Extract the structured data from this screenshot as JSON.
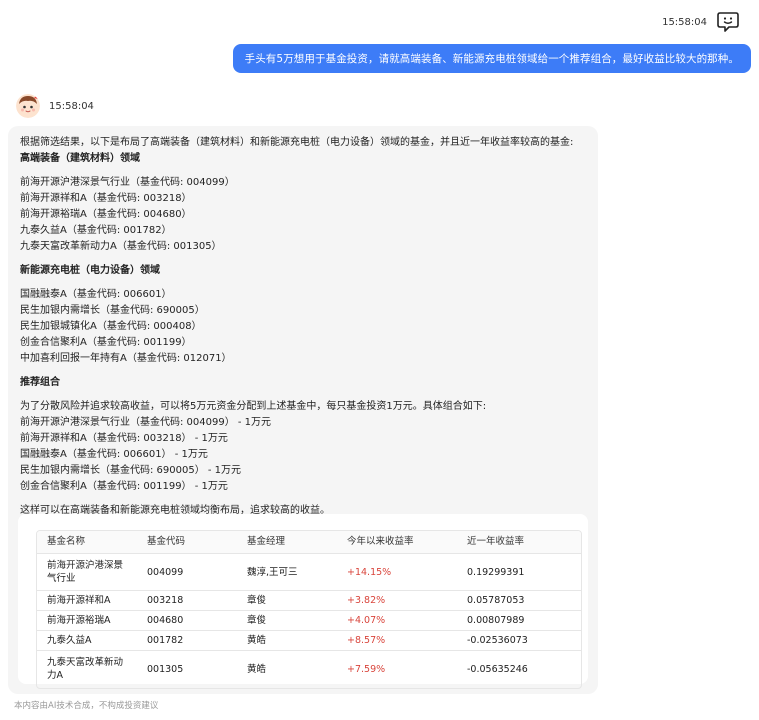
{
  "user": {
    "time": "15:58:04",
    "message": "手头有5万想用于基金投资，请就高端装备、新能源充电桩领域给一个推荐组合，最好收益比较大的那种。"
  },
  "bot": {
    "time": "15:58:04",
    "intro": "根据筛选结果，以下是布局了高端装备（建筑材料）和新能源充电桩（电力设备）领域的基金，并且近一年收益率较高的基金:",
    "section1": {
      "title": "高端装备（建筑材料）领域",
      "items": [
        "前海开源沪港深景气行业（基金代码: 004099）",
        "前海开源祥和A（基金代码: 003218）",
        "前海开源裕瑞A（基金代码: 004680）",
        "九泰久益A（基金代码: 001782）",
        "九泰天富改革新动力A（基金代码: 001305）"
      ]
    },
    "section2": {
      "title": "新能源充电桩（电力设备）领域",
      "items": [
        "国融融泰A（基金代码: 006601）",
        "民生加银内需增长（基金代码: 690005）",
        "民生加银城镇化A（基金代码: 000408）",
        "创金合信聚利A（基金代码: 001199）",
        "中加喜利回报一年持有A（基金代码: 012071）"
      ]
    },
    "section3": {
      "title": "推荐组合",
      "intro": "为了分散风险并追求较高收益，可以将5万元资金分配到上述基金中，每只基金投资1万元。具体组合如下:",
      "items": [
        "前海开源沪港深景气行业（基金代码: 004099） - 1万元",
        "前海开源祥和A（基金代码: 003218） - 1万元",
        "国融融泰A（基金代码: 006601） - 1万元",
        "民生加银内需增长（基金代码: 690005） - 1万元",
        "创金合信聚利A（基金代码: 001199） - 1万元"
      ]
    },
    "conclusion": "这样可以在高端装备和新能源充电桩领域均衡布局，追求较高的收益。"
  },
  "table": {
    "headers": [
      "基金名称",
      "基金代码",
      "基金经理",
      "今年以来收益率",
      "近一年收益率"
    ],
    "rows": [
      {
        "name": "前海开源沪港深景气行业",
        "code": "004099",
        "manager": "魏淳,王可三",
        "ytd": "+14.15%",
        "year": "0.19299391"
      },
      {
        "name": "前海开源祥和A",
        "code": "003218",
        "manager": "章俊",
        "ytd": "+3.82%",
        "year": "0.05787053"
      },
      {
        "name": "前海开源裕瑞A",
        "code": "004680",
        "manager": "章俊",
        "ytd": "+4.07%",
        "year": "0.00807989"
      },
      {
        "name": "九泰久益A",
        "code": "001782",
        "manager": "黄皓",
        "ytd": "+8.57%",
        "year": "-0.02536073"
      },
      {
        "name": "九泰天富改革新动力A",
        "code": "001305",
        "manager": "黄皓",
        "ytd": "+7.59%",
        "year": "-0.05635246"
      }
    ]
  },
  "disclaimer": "本内容由AI技术合成，不构成投资建议",
  "colors": {
    "user_bubble": "#3d7cf7",
    "positive_return": "#d9453c",
    "bot_bubble_bg": "#f5f5f5"
  },
  "icons": {
    "user_avatar": "chat-face-icon",
    "bot_avatar": "cartoon-avatar-icon"
  }
}
